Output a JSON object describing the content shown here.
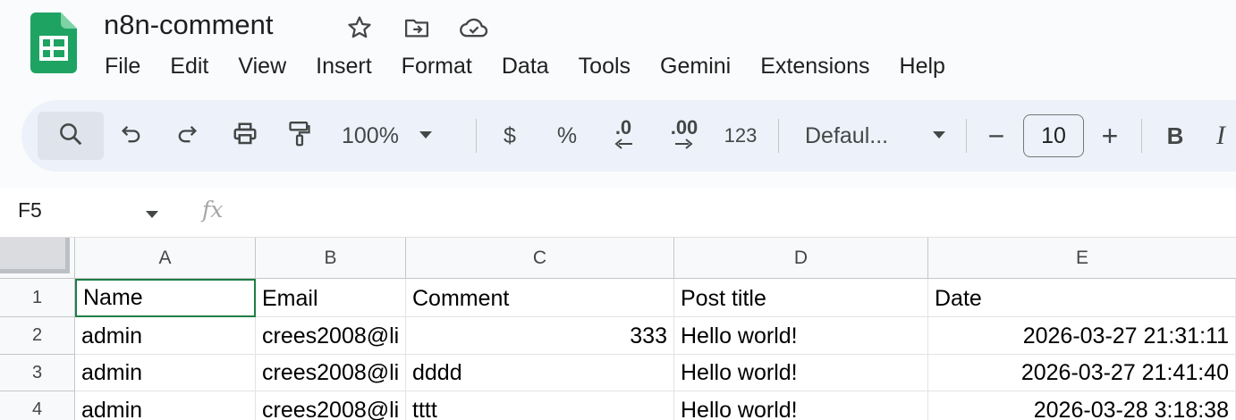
{
  "app": {
    "title": "n8n-comment",
    "brand_color": "#1ea362"
  },
  "title_icons": [
    "star-icon",
    "move-folder-icon",
    "cloud-saved-icon"
  ],
  "menu": [
    "File",
    "Edit",
    "View",
    "Insert",
    "Format",
    "Data",
    "Tools",
    "Gemini",
    "Extensions",
    "Help"
  ],
  "toolbar": {
    "zoom": "100%",
    "currency": "$",
    "percent": "%",
    "decrease_decimal": ".0",
    "increase_decimal": ".00",
    "number_format": "123",
    "font": "Defaul...",
    "font_size": "10",
    "decrease": "−",
    "increase": "+",
    "bold": "B",
    "italic": "I"
  },
  "formula_bar": {
    "cell_ref": "F5",
    "fx": "fx"
  },
  "sheet": {
    "columns": [
      "A",
      "B",
      "C",
      "D",
      "E"
    ],
    "rows": [
      {
        "num": "1",
        "cells": [
          "Name",
          "Email",
          "Comment",
          "Post title",
          "Date"
        ]
      },
      {
        "num": "2",
        "cells": [
          "admin",
          "crees2008@li",
          "333",
          "Hello world!",
          "2026-03-27 21:31:11"
        ]
      },
      {
        "num": "3",
        "cells": [
          "admin",
          "crees2008@li",
          "dddd",
          "Hello world!",
          "2026-03-27 21:41:40"
        ]
      },
      {
        "num": "4",
        "cells": [
          "admin",
          "crees2008@li",
          "tttt",
          "Hello world!",
          "2026-03-28 3:18:38"
        ]
      }
    ]
  }
}
